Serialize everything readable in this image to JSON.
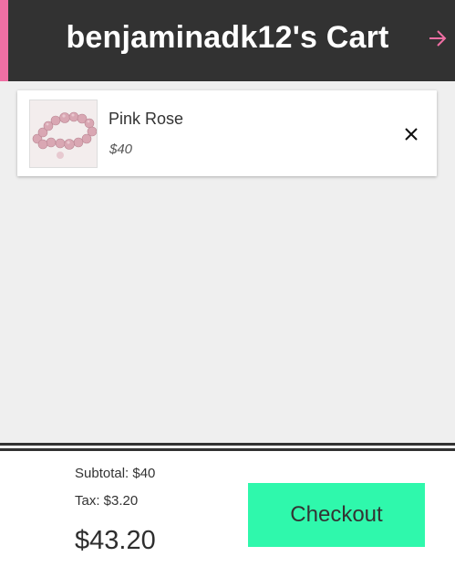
{
  "header": {
    "title": "benjaminadk12's Cart",
    "accent_color": "#f06fa4",
    "icon": "arrow-right-icon"
  },
  "cart": {
    "items": [
      {
        "name": "Pink Rose",
        "price": "$40",
        "image": "rose-quartz-bracelet",
        "remove_icon": "close-icon"
      }
    ]
  },
  "summary": {
    "subtotal": "Subtotal: $40",
    "tax": "Tax: $3.20",
    "total": "$43.20",
    "checkout_label": "Checkout",
    "checkout_color": "#2ff8ac"
  }
}
